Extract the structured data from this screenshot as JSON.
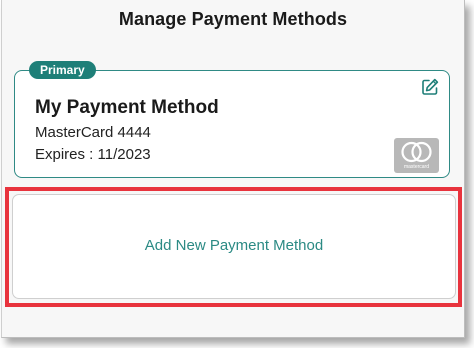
{
  "header": {
    "title": "Manage Payment Methods"
  },
  "primary_card": {
    "badge": "Primary",
    "name": "My Payment Method",
    "card_line": "MasterCard 4444",
    "expiry_line": "Expires : 11/2023",
    "edit_icon": "edit-pencil-icon",
    "brand_logo": "mastercard-logo",
    "brand_logo_text": "mastercard"
  },
  "add_method": {
    "label": "Add New Payment Method"
  },
  "colors": {
    "accent": "#1e7f78",
    "link": "#2b8a84",
    "highlight": "#e8333d"
  }
}
